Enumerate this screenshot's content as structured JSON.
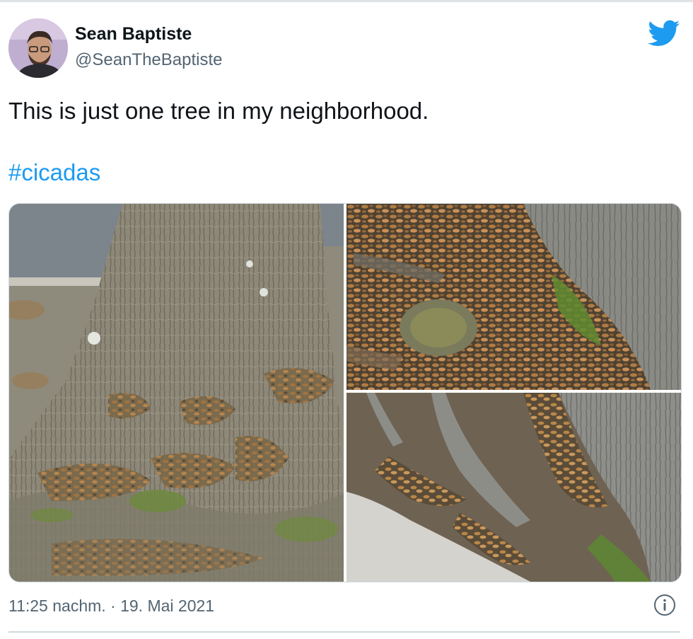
{
  "tweet": {
    "author_name": "Sean Baptiste",
    "author_handle": "@SeanTheBaptiste",
    "text": "This is just one tree in my neighborhood.",
    "hashtag": "#cicadas",
    "timestamp": "11:25 nachm. · 19. Mai 2021"
  },
  "icons": {
    "brand": "twitter-bird-icon",
    "info": "info-icon"
  },
  "colors": {
    "accent": "#1d9bf0",
    "text": "#0f1419",
    "secondary_text": "#536471",
    "border": "#cfd9de"
  }
}
